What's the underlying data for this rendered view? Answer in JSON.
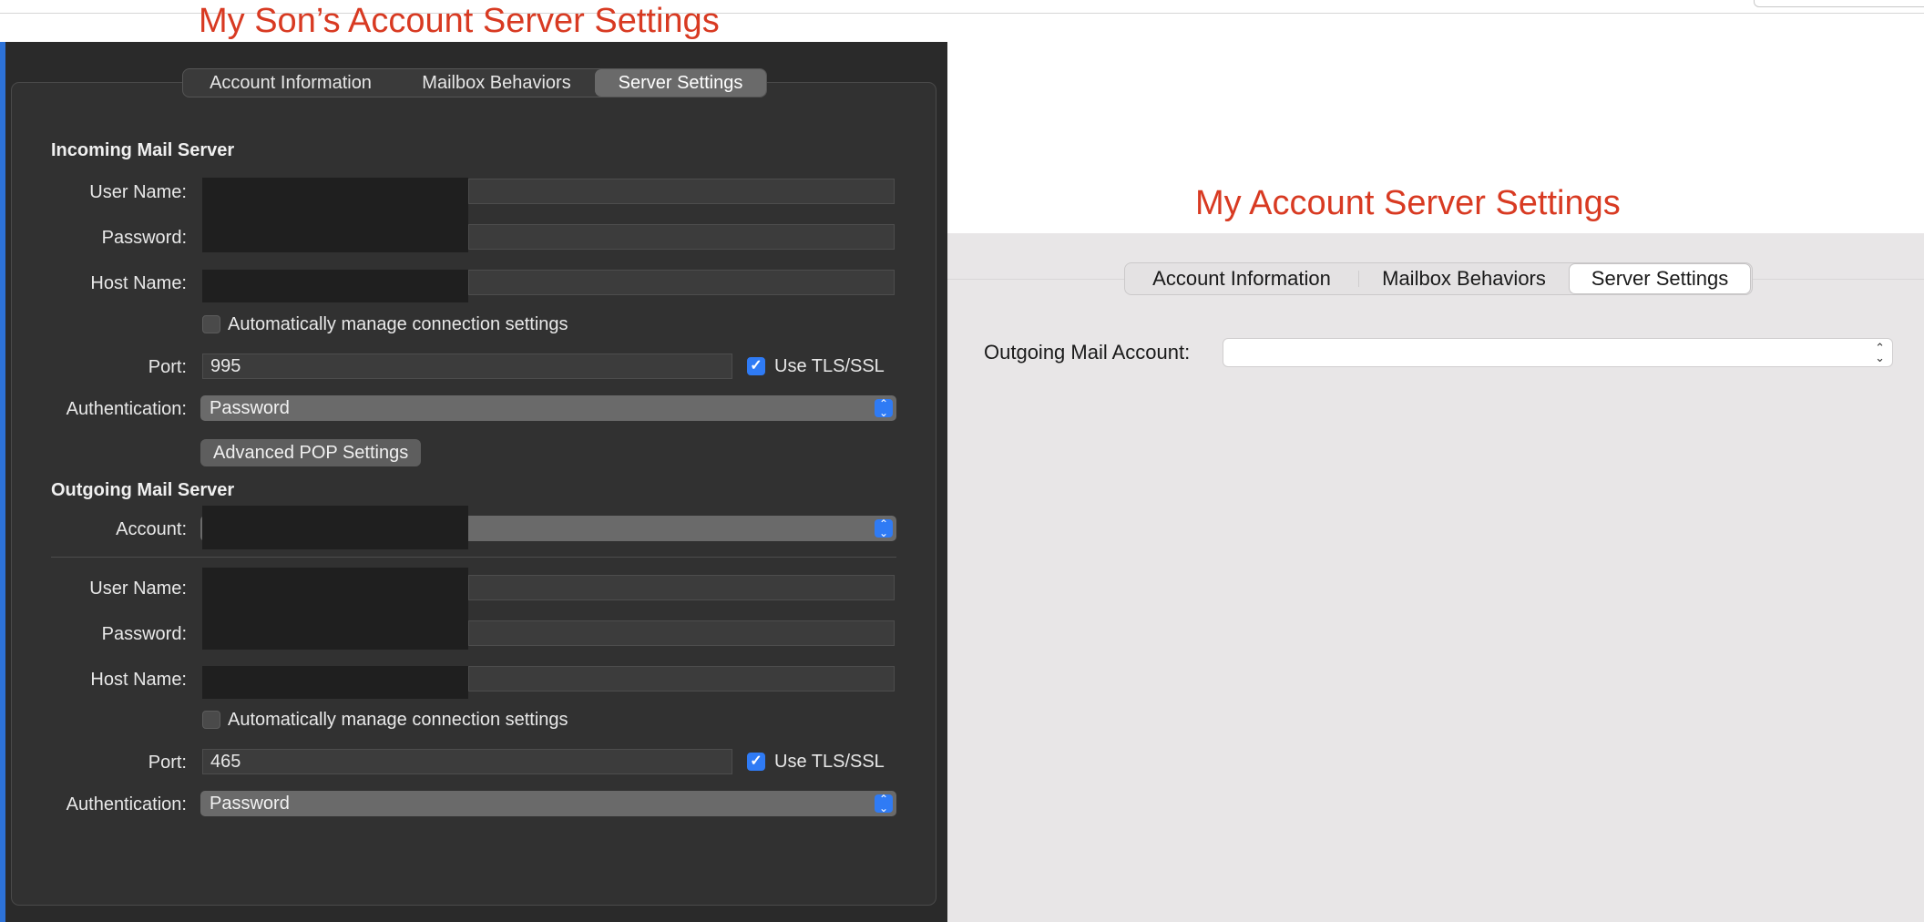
{
  "annotations": {
    "left_title": "My Son’s Account Server Settings",
    "right_title": "My Account Server Settings"
  },
  "left_panel": {
    "tabs": [
      "Account Information",
      "Mailbox Behaviors",
      "Server Settings"
    ],
    "selected_tab": "Server Settings",
    "incoming": {
      "section_title": "Incoming Mail Server",
      "user_name_label": "User Name:",
      "password_label": "Password:",
      "host_name_label": "Host Name:",
      "auto_manage_label": "Automatically manage connection settings",
      "auto_manage_checked": false,
      "port_label": "Port:",
      "port_value": "995",
      "tls_label": "Use TLS/SSL",
      "tls_checked": true,
      "auth_label": "Authentication:",
      "auth_value": "Password",
      "advanced_button": "Advanced POP Settings"
    },
    "outgoing": {
      "section_title": "Outgoing Mail Server",
      "account_label": "Account:",
      "user_name_label": "User Name:",
      "password_label": "Password:",
      "host_name_label": "Host Name:",
      "auto_manage_label": "Automatically manage connection settings",
      "auto_manage_checked": false,
      "port_label": "Port:",
      "port_value": "465",
      "tls_label": "Use TLS/SSL",
      "tls_checked": true,
      "auth_label": "Authentication:",
      "auth_value": "Password"
    }
  },
  "right_panel": {
    "tabs": [
      "Account Information",
      "Mailbox Behaviors",
      "Server Settings"
    ],
    "selected_tab": "Server Settings",
    "outgoing_account_label": "Outgoing Mail Account:",
    "outgoing_account_value": ""
  },
  "colors": {
    "annotation": "#d83a22",
    "dark_bg": "#2a2a2a",
    "accent_blue": "#2f7bf5",
    "light_bg": "#e8e6e7"
  }
}
